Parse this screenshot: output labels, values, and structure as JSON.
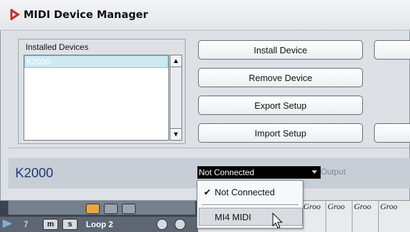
{
  "window": {
    "title": "MIDI Device Manager",
    "title_icon": "cubase-logo-icon"
  },
  "installed_devices": {
    "label": "Installed Devices",
    "items": [
      "K2000"
    ],
    "selected_index": 0
  },
  "buttons": {
    "install": "Install Device",
    "remove": "Remove Device",
    "export": "Export Setup",
    "import": "Import Setup"
  },
  "device_panel": {
    "device_name": "K2000",
    "port_value": "Not Connected",
    "port_type_label": "Output"
  },
  "port_dropdown": {
    "options": [
      "Not Connected",
      "MI4 MIDI"
    ],
    "checked_option": "Not Connected",
    "hovered_option": "MI4 MIDI"
  },
  "track": {
    "number": "7",
    "mute_label": "m",
    "solo_label": "s",
    "name": "Loop 2"
  },
  "lane": {
    "groove_labels": [
      "Groo",
      "Groo",
      "Groo",
      "Groo"
    ]
  },
  "colors": {
    "accent_title_icon": "#c0392b",
    "device_name": "#1f3a78",
    "selection_border": "#7fc7d4",
    "toolbar_active": "#e8a83a"
  }
}
